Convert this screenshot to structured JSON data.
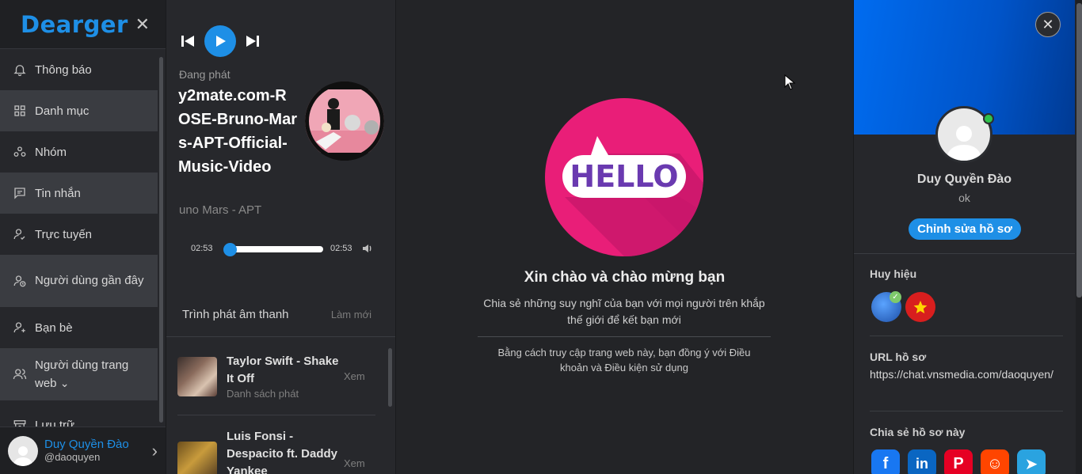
{
  "sidebar": {
    "logo": "Dearger",
    "close_icon": "close-icon",
    "items": [
      {
        "label": "Thông báo",
        "icon": "bell-icon"
      },
      {
        "label": "Danh mục",
        "icon": "grid-icon"
      },
      {
        "label": "Nhóm",
        "icon": "group-icon"
      },
      {
        "label": "Tin nhắn",
        "icon": "message-icon"
      },
      {
        "label": "Trực tuyến",
        "icon": "user-check-icon"
      },
      {
        "label": "Người dùng gần đây",
        "icon": "user-clock-icon"
      },
      {
        "label": "Bạn bè",
        "icon": "user-plus-icon"
      },
      {
        "label": "Người dùng trang web",
        "icon": "users-icon"
      },
      {
        "label": "Lưu trữ",
        "icon": "archive-icon"
      }
    ],
    "user": {
      "name": "Duy Quyền Đào",
      "handle": "@daoquyen"
    }
  },
  "player": {
    "now_playing_label": "Đang phát",
    "title": "y2mate.com-ROSE-Bruno-Mars-APT-Official-Music-Video",
    "subtitle": "uno Mars - APT",
    "time_current": "02:53",
    "time_total": "02:53",
    "progress": 0,
    "playlist_title": "Trình phát âm thanh",
    "refresh_label": "Làm mới",
    "songs": [
      {
        "name": "Taylor Swift - Shake It Off",
        "category": "Danh sách phát",
        "action": "Xem"
      },
      {
        "name": "Luis Fonsi - Despacito ft. Daddy Yankee",
        "category": "",
        "action": "Xem"
      }
    ]
  },
  "welcome": {
    "hello_text": "HELLO",
    "title": "Xin chào và chào mừng bạn",
    "description": "Chia sẻ những suy nghĩ của bạn với mọi người trên khắp thế giới để kết bạn mới",
    "terms": "Bằng cách truy cập trang web này, bạn đồng ý với Điều khoản và Điều kiện sử dụng"
  },
  "profile": {
    "name": "Duy Quyền Đào",
    "status": "ok",
    "edit_button": "Chỉnh sửa hồ sơ",
    "badges_label": "Huy hiệu",
    "url_label": "URL hồ sơ",
    "url": "https://chat.vnsmedia.com/daoquyen/",
    "share_label": "Chia sẻ hồ sơ này",
    "share_icons": [
      "facebook-icon",
      "linkedin-icon",
      "pinterest-icon",
      "reddit-icon",
      "telegram-icon"
    ]
  },
  "colors": {
    "accent": "#1e8fe6",
    "hello_pink": "#e91e78",
    "hello_text": "#6a3ab0",
    "online": "#2fc24b"
  }
}
